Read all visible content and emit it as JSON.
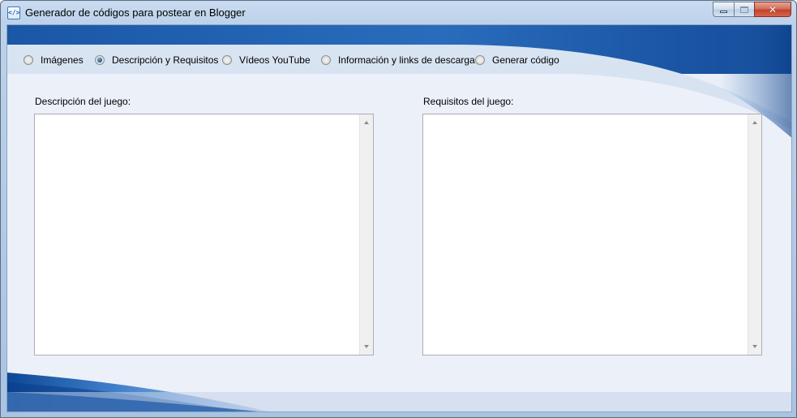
{
  "window": {
    "title": "Generador de códigos para postear en Blogger",
    "app_icon": "code-icon",
    "controls": {
      "minimize": "minimize-icon",
      "maximize": "maximize-icon",
      "close": "close-icon"
    }
  },
  "tabs": [
    {
      "label": "Imágenes",
      "checked": false
    },
    {
      "label": "Descripción y Requisitos",
      "checked": true
    },
    {
      "label": "Vídeos YouTube",
      "checked": false
    },
    {
      "label": "Información y links de descarga",
      "checked": false
    },
    {
      "label": "Generar código",
      "checked": false
    }
  ],
  "fields": {
    "description": {
      "label": "Descripción del juego:",
      "value": ""
    },
    "requirements": {
      "label": "Requisitos del juego:",
      "value": ""
    }
  },
  "colors": {
    "header_blue": "#1f5fad",
    "accent_dark": "#0c3f86",
    "client_bg": "#e9eef7"
  }
}
